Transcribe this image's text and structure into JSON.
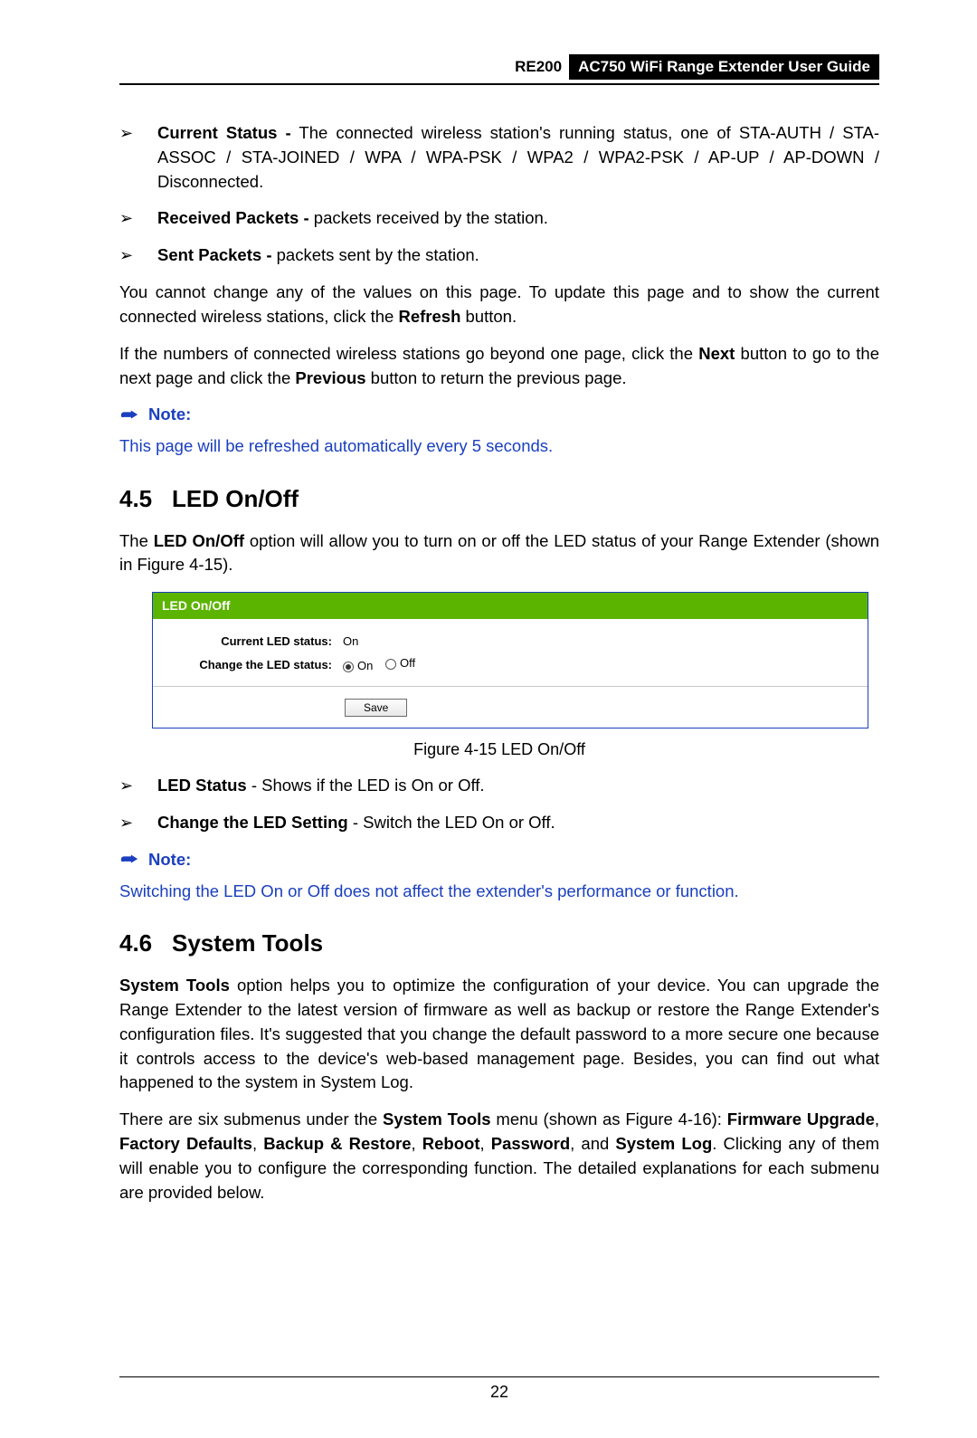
{
  "header": {
    "model": "RE200",
    "title": "AC750 WiFi Range Extender User Guide"
  },
  "bullets_top": [
    {
      "lead": "Current Status -",
      "rest": " The connected wireless station's running status, one of STA-AUTH / STA-ASSOC / STA-JOINED / WPA / WPA-PSK / WPA2 / WPA2-PSK / AP-UP / AP-DOWN / Disconnected."
    },
    {
      "lead": "Received Packets -",
      "rest": " packets received by the station."
    },
    {
      "lead": "Sent Packets -",
      "rest": " packets sent by the station."
    }
  ],
  "para1_a": "You cannot change any of the values on this page. To update this page and to show the current connected wireless stations, click the ",
  "para1_b": "Refresh",
  "para1_c": " button.",
  "para2_a": "If the numbers of connected wireless stations go beyond one page, click the ",
  "para2_b": "Next",
  "para2_c": " button to go to the next page and click the ",
  "para2_d": "Previous",
  "para2_e": " button to return the previous page.",
  "note_label": "Note:",
  "note1_body": "This page will be refreshed automatically every 5 seconds.",
  "sect45_num": "4.5",
  "sect45_title": "LED On/Off",
  "sect45_para_a": "The ",
  "sect45_para_b": "LED On/Off",
  "sect45_para_c": " option will allow you to turn on or off the LED status of your Range Extender (shown in Figure 4-15).",
  "figure": {
    "header": "LED On/Off",
    "row1_label": "Current LED status:",
    "row1_value": "On",
    "row2_label": "Change the LED status:",
    "opt_on": "On",
    "opt_off": "Off",
    "save": "Save",
    "caption": "Figure 4-15 LED On/Off"
  },
  "bullets_mid": [
    {
      "lead": "LED Status",
      "rest": " - Shows if the LED is On or Off."
    },
    {
      "lead": "Change the LED Setting",
      "rest": " - Switch the LED On or Off."
    }
  ],
  "note2_body": "Switching the LED On or Off does not affect the extender's performance or function.",
  "sect46_num": "4.6",
  "sect46_title": "System Tools",
  "sect46_para1_a": "System Tools",
  "sect46_para1_b": " option helps you to optimize the configuration of your device. You can upgrade the Range Extender to the latest version of firmware as well as backup or restore the Range Extender's configuration files. It's suggested that you change the default password to a more secure one because it controls access to the device's web-based management page. Besides, you can find out what happened to the system in System Log.",
  "sect46_para2_a": "There are six submenus under the ",
  "sect46_para2_b": "System Tools",
  "sect46_para2_c": " menu (shown as Figure 4-16): ",
  "sect46_para2_d": "Firmware Upgrade",
  "sect46_para2_e": ", ",
  "sect46_para2_f": "Factory Defaults",
  "sect46_para2_g": ", ",
  "sect46_para2_h": "Backup & Restore",
  "sect46_para2_i": ", ",
  "sect46_para2_j": "Reboot",
  "sect46_para2_k": ", ",
  "sect46_para2_l": "Password",
  "sect46_para2_m": ", and ",
  "sect46_para2_n": "System Log",
  "sect46_para2_o": ". Clicking any of them will enable you to configure the corresponding function. The detailed explanations for each submenu are provided below.",
  "page_number": "22",
  "bullet_glyph": "➢"
}
